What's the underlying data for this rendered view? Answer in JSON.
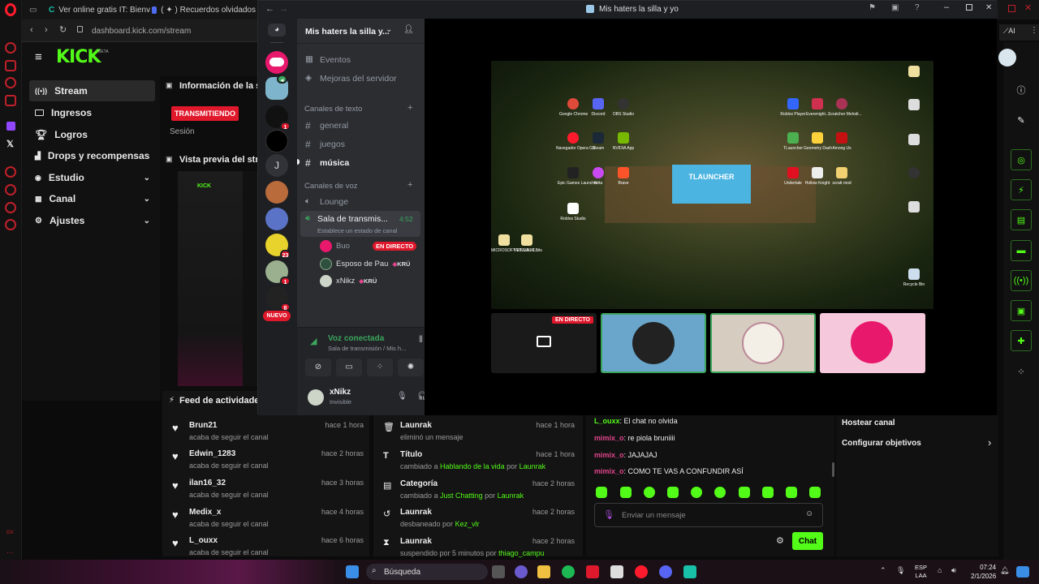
{
  "browser": {
    "tabs": [
      {
        "label": "Ver online gratis IT: Bienv"
      },
      {
        "label": "( ✦ ) Recuerdos olvidados"
      }
    ],
    "address": "dashboard.kick.com/stream"
  },
  "kick": {
    "logo": "KICK",
    "beta": "BETA",
    "nav": [
      {
        "label": "Stream",
        "icon": "broadcast-icon",
        "active": true
      },
      {
        "label": "Ingresos",
        "icon": "money-icon"
      },
      {
        "label": "Logros",
        "icon": "trophy-icon"
      },
      {
        "label": "Drops y recompensas",
        "icon": "drops-icon"
      },
      {
        "label": "Estudio",
        "icon": "studio-icon",
        "expand": true
      },
      {
        "label": "Canal",
        "icon": "channel-icon",
        "expand": true
      },
      {
        "label": "Ajustes",
        "icon": "settings-icon",
        "expand": true
      }
    ],
    "session_title": "Información de la ses",
    "live_badge": "TRANSMITIENDO",
    "session_label": "Sesión",
    "preview_title": "Vista previa del strea",
    "feed_title": "Feed de actividades",
    "feed": [
      {
        "name": "Brun21",
        "action": "acaba de seguir el canal",
        "time": "hace 1 hora"
      },
      {
        "name": "Edwin_1283",
        "action": "acaba de seguir el canal",
        "time": "hace 2 horas"
      },
      {
        "name": "ilan16_32",
        "action": "acaba de seguir el canal",
        "time": "hace 3 horas"
      },
      {
        "name": "Medix_x",
        "action": "acaba de seguir el canal",
        "time": "hace 4 horas"
      },
      {
        "name": "L_ouxx",
        "action": "acaba de seguir el canal",
        "time": "hace 6 horas"
      }
    ],
    "mod_log": [
      {
        "name": "Launrak",
        "pre": "eliminó un mensaje",
        "hl": "",
        "post": "",
        "by": "",
        "time": "hace 1 hora",
        "icon": "trash-icon"
      },
      {
        "name": "Título",
        "pre": "cambiado a",
        "hl": "Hablando de la vida",
        "post": "por",
        "by": "Launrak",
        "time": "hace 1 hora",
        "icon": "title-icon"
      },
      {
        "name": "Categoría",
        "pre": "cambiado a",
        "hl": "Just Chatting",
        "post": "por",
        "by": "Launrak",
        "time": "hace 2 horas",
        "icon": "category-icon"
      },
      {
        "name": "Launrak",
        "pre": "desbaneado por",
        "hl": "Kez_vlr",
        "post": "",
        "by": "",
        "time": "hace 2 horas",
        "icon": "unban-icon"
      },
      {
        "name": "Launrak",
        "pre": "suspendido por 5 minutos por",
        "hl": "thiago_campu",
        "post": "",
        "by": "",
        "time": "hace 2 horas",
        "icon": "hourglass-icon"
      }
    ],
    "chat": [
      {
        "user": "L_ouxx",
        "text": "El chat no olvida",
        "color": "#53fc18"
      },
      {
        "user": "mimix_o",
        "text": "re piola bruniiii",
        "color": "#e0458c"
      },
      {
        "user": "mimix_o",
        "text": "JAJAJAJ",
        "color": "#e0458c"
      },
      {
        "user": "mimix_o",
        "text": "COMO TE VAS A CONFUNDIR ASÍ",
        "color": "#e0458c"
      }
    ],
    "chat_placeholder": "Enviar un mensaje",
    "chat_button": "Chat",
    "settings": [
      {
        "label": "Hostear canal"
      },
      {
        "label": "Configurar objetivos"
      }
    ]
  },
  "discord": {
    "title": "Mis haters la silla y yo",
    "server_name": "Mis haters la silla y...",
    "events": "Eventos",
    "boost": "Mejoras del servidor",
    "text_category": "Canales de texto",
    "text_channels": [
      "general",
      "juegos",
      "música"
    ],
    "voice_category": "Canales de voz",
    "voice_channels": [
      "Lounge"
    ],
    "stage_channel": "Sala de transmis...",
    "stage_timer": "4:52",
    "stage_status": "Establece un estado de canal",
    "voice_users": [
      {
        "name": "Buo",
        "tag": "EN DIRECTO"
      },
      {
        "name": "Esposo de Pau",
        "tag": "KRÜ"
      },
      {
        "name": "xNikz",
        "tag": "KRÜ"
      }
    ],
    "server_badges": [
      "1",
      "23",
      "1",
      "8"
    ],
    "new_label": "NUEVO",
    "voice_connected": "Voz conectada",
    "voice_connected_sub": "Sala de transmisión / Mis h...",
    "user_name": "xNikz",
    "user_status": "Invisible",
    "tile_live": "EN DIRECTO",
    "desktop_icons": [
      "Google Chrome",
      "Discord",
      "OBS Studio",
      "Navegador Opera GX",
      "Steam",
      "NVIDIA App",
      "Epic Games Launcher",
      "Krita",
      "Brave",
      "Roblox Studio",
      "Roblox Player",
      "Everenight...",
      "Scratcher Melodi...",
      "TLauncher",
      "Geometry Dash",
      "Among Us",
      "Undertale",
      "Hollow Knight",
      "scratt mod",
      "MICROSOFT VISUAL C...",
      "NET 6.0 64 Bits",
      "Recycle Bin"
    ],
    "tlauncher_label": "TLAUNCHER"
  },
  "taskbar": {
    "search": "Búsqueda",
    "lang": "ESP",
    "lang2": "LAA",
    "time": "07:24",
    "date": "2/1/2026"
  }
}
